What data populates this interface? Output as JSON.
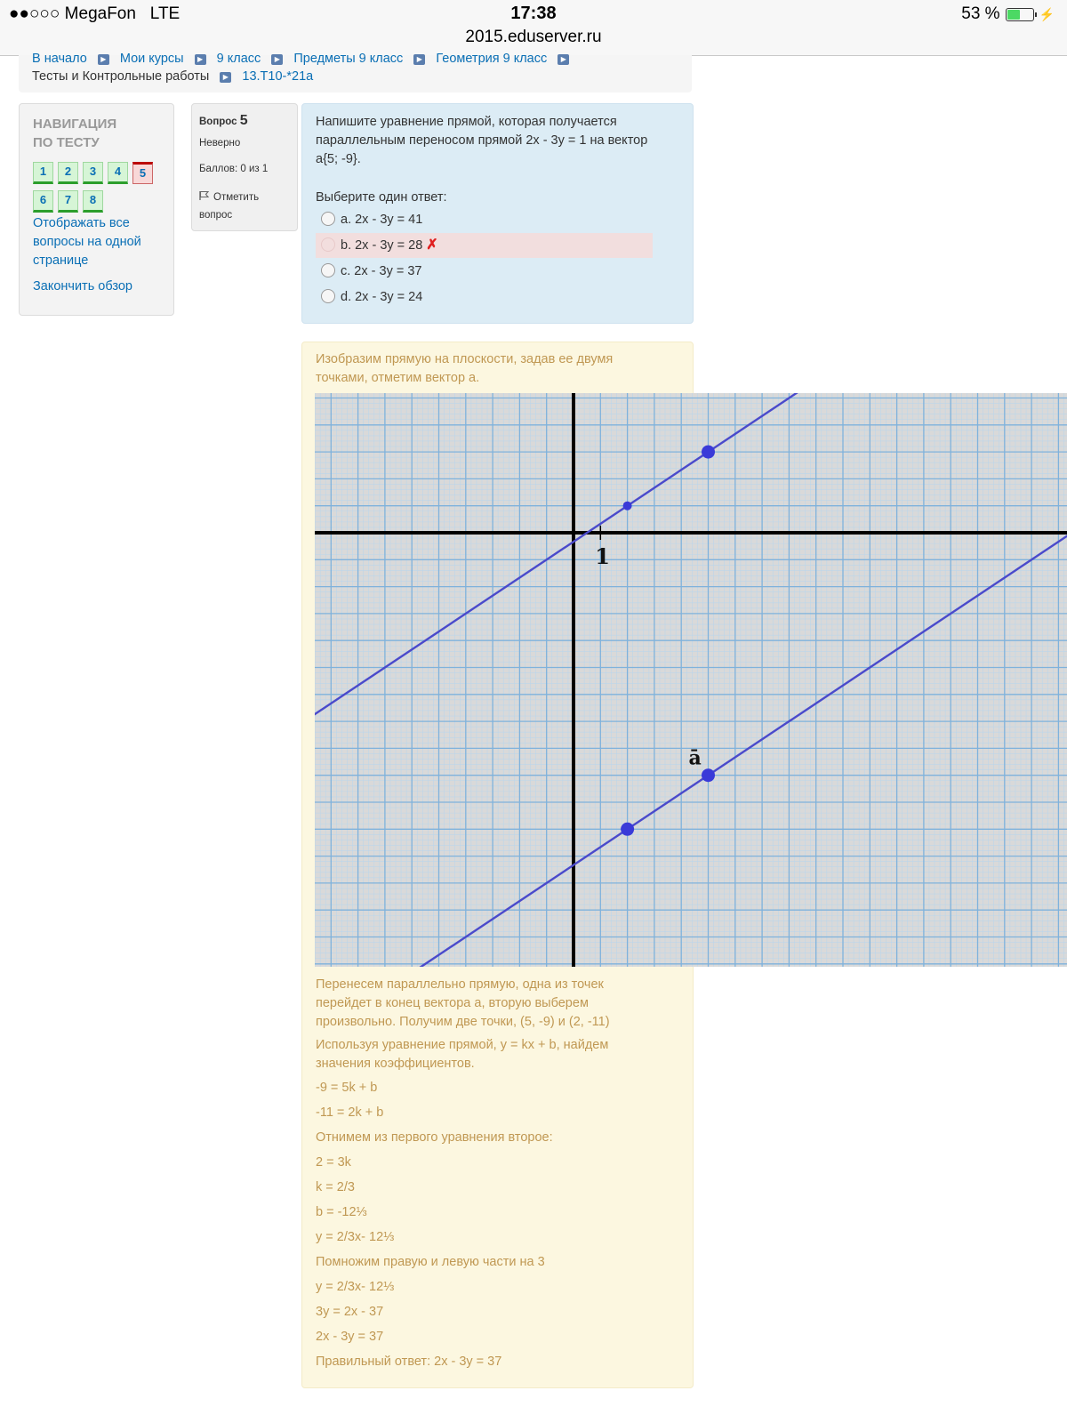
{
  "status_bar": {
    "signal": "●●○○○",
    "carrier": "MegaFon",
    "network": "LTE",
    "time": "17:38",
    "url": "2015.eduserver.ru",
    "battery": "53 %",
    "battery_level": 0.53
  },
  "breadcrumb": {
    "items": [
      "В начало",
      "Мои курсы",
      "9 класс",
      "Предметы 9 класс",
      "Геометрия 9 класс",
      "Тесты и Контрольные работы",
      "13.Т10-*21а"
    ]
  },
  "navigation": {
    "title_line1": "НАВИГАЦИЯ",
    "title_line2": "ПО ТЕСТУ",
    "questions": [
      "1",
      "2",
      "3",
      "4",
      "5",
      "6",
      "7",
      "8"
    ],
    "current": "5",
    "show_all_line1": "Отображать все",
    "show_all_line2": "вопросы на одной",
    "show_all_line3": "странице",
    "finish_review": "Закончить обзор"
  },
  "question_info": {
    "label": "Вопрос",
    "number": "5",
    "state": "Неверно",
    "grade": "Баллов: 0 из 1",
    "flag_line1": "Отметить",
    "flag_line2": "вопрос"
  },
  "question": {
    "text_line1": "Напишите уравнение прямой, которая получается",
    "text_line2": "параллельным переносом прямой 2х - 3у = 1 на вектор",
    "text_line3": "а{5; -9}.",
    "prompt": "Выберите один ответ:",
    "options": [
      {
        "label": "a. 2x - 3y = 41"
      },
      {
        "label": "b. 2x - 3y = 28"
      },
      {
        "label": "c. 2x - 3y = 37"
      },
      {
        "label": "d. 2x - 3y = 24"
      }
    ],
    "selected_wrong_index": 1,
    "wrong_mark": "✗"
  },
  "feedback": {
    "intro_line1": "Изобразим прямую на плоскости, задав ее двумя",
    "intro_line2": "точками, отметим вектор а.",
    "graph": {
      "tick_label": "1",
      "vector_label": "ā",
      "line_color": "#4a4acb",
      "original_line": "2x - 3y = 1",
      "shifted_line": "2x - 3y = 37",
      "points": [
        [
          5,
          3
        ],
        [
          2,
          1
        ],
        [
          5,
          -9
        ],
        [
          2,
          -11
        ]
      ]
    },
    "p1_line1": "Перенесем параллельно прямую, одна из точек",
    "p1_line2": "перейдет в конец вектора а, вторую выберем",
    "p1_line3": "произвольно. Получим две точки, (5, -9) и (2, -11)",
    "p2_line1": "Используя уравнение прямой, у = kx + b, найдем",
    "p2_line2": "значения коэффициентов.",
    "lines": [
      "-9 = 5k + b",
      "-11 = 2k + b",
      "Отнимем из первого уравнения второе:",
      "2 = 3k",
      "k = 2/3",
      "b = -12⅓",
      "y = 2/3x- 12⅓",
      "Помножим правую и левую части на 3",
      "y = 2/3x- 12⅓",
      "3y = 2x - 37",
      "2x - 3y = 37",
      "Правильный ответ: 2x - 3y = 37"
    ]
  }
}
